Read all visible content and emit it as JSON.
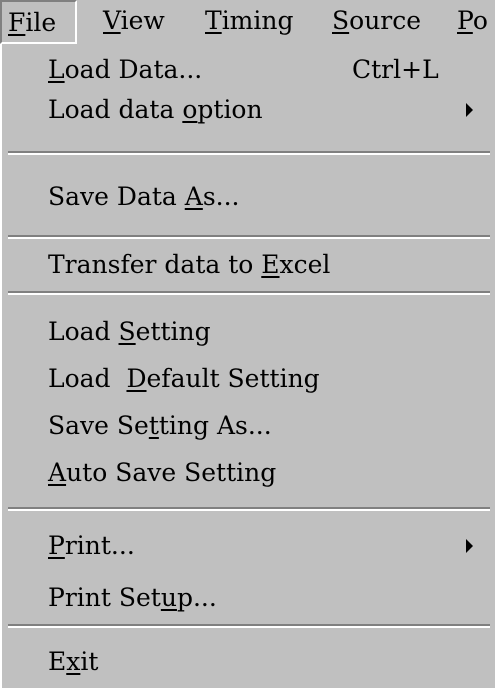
{
  "menubar": {
    "items": [
      {
        "pre": "",
        "accel": "F",
        "post": "ile"
      },
      {
        "pre": "",
        "accel": "V",
        "post": "iew"
      },
      {
        "pre": "",
        "accel": "T",
        "post": "iming"
      },
      {
        "pre": "",
        "accel": "S",
        "post": "ource"
      },
      {
        "pre": "",
        "accel": "P",
        "post": "o"
      }
    ]
  },
  "menu": {
    "items": [
      {
        "pre": "",
        "accel": "L",
        "post": "oad Data...",
        "shortcut": "Ctrl+L"
      },
      {
        "pre": "Load data ",
        "accel": "o",
        "post": "ption",
        "submenu": true
      },
      {
        "pre": "Save Data ",
        "accel": "A",
        "post": "s..."
      },
      {
        "pre": "Transfer data to ",
        "accel": "E",
        "post": "xcel"
      },
      {
        "pre": "Load ",
        "accel": "S",
        "post": "etting"
      },
      {
        "pre": "Load  ",
        "accel": "D",
        "post": "efault Setting"
      },
      {
        "pre": "Save Se",
        "accel": "t",
        "post": "ting As..."
      },
      {
        "pre": "",
        "accel": "A",
        "post": "uto Save Setting"
      },
      {
        "pre": "",
        "accel": "P",
        "post": "rint...",
        "submenu": true
      },
      {
        "pre": "Print Set",
        "accel": "u",
        "post": "p..."
      },
      {
        "pre": "E",
        "accel": "x",
        "post": "it"
      }
    ]
  }
}
